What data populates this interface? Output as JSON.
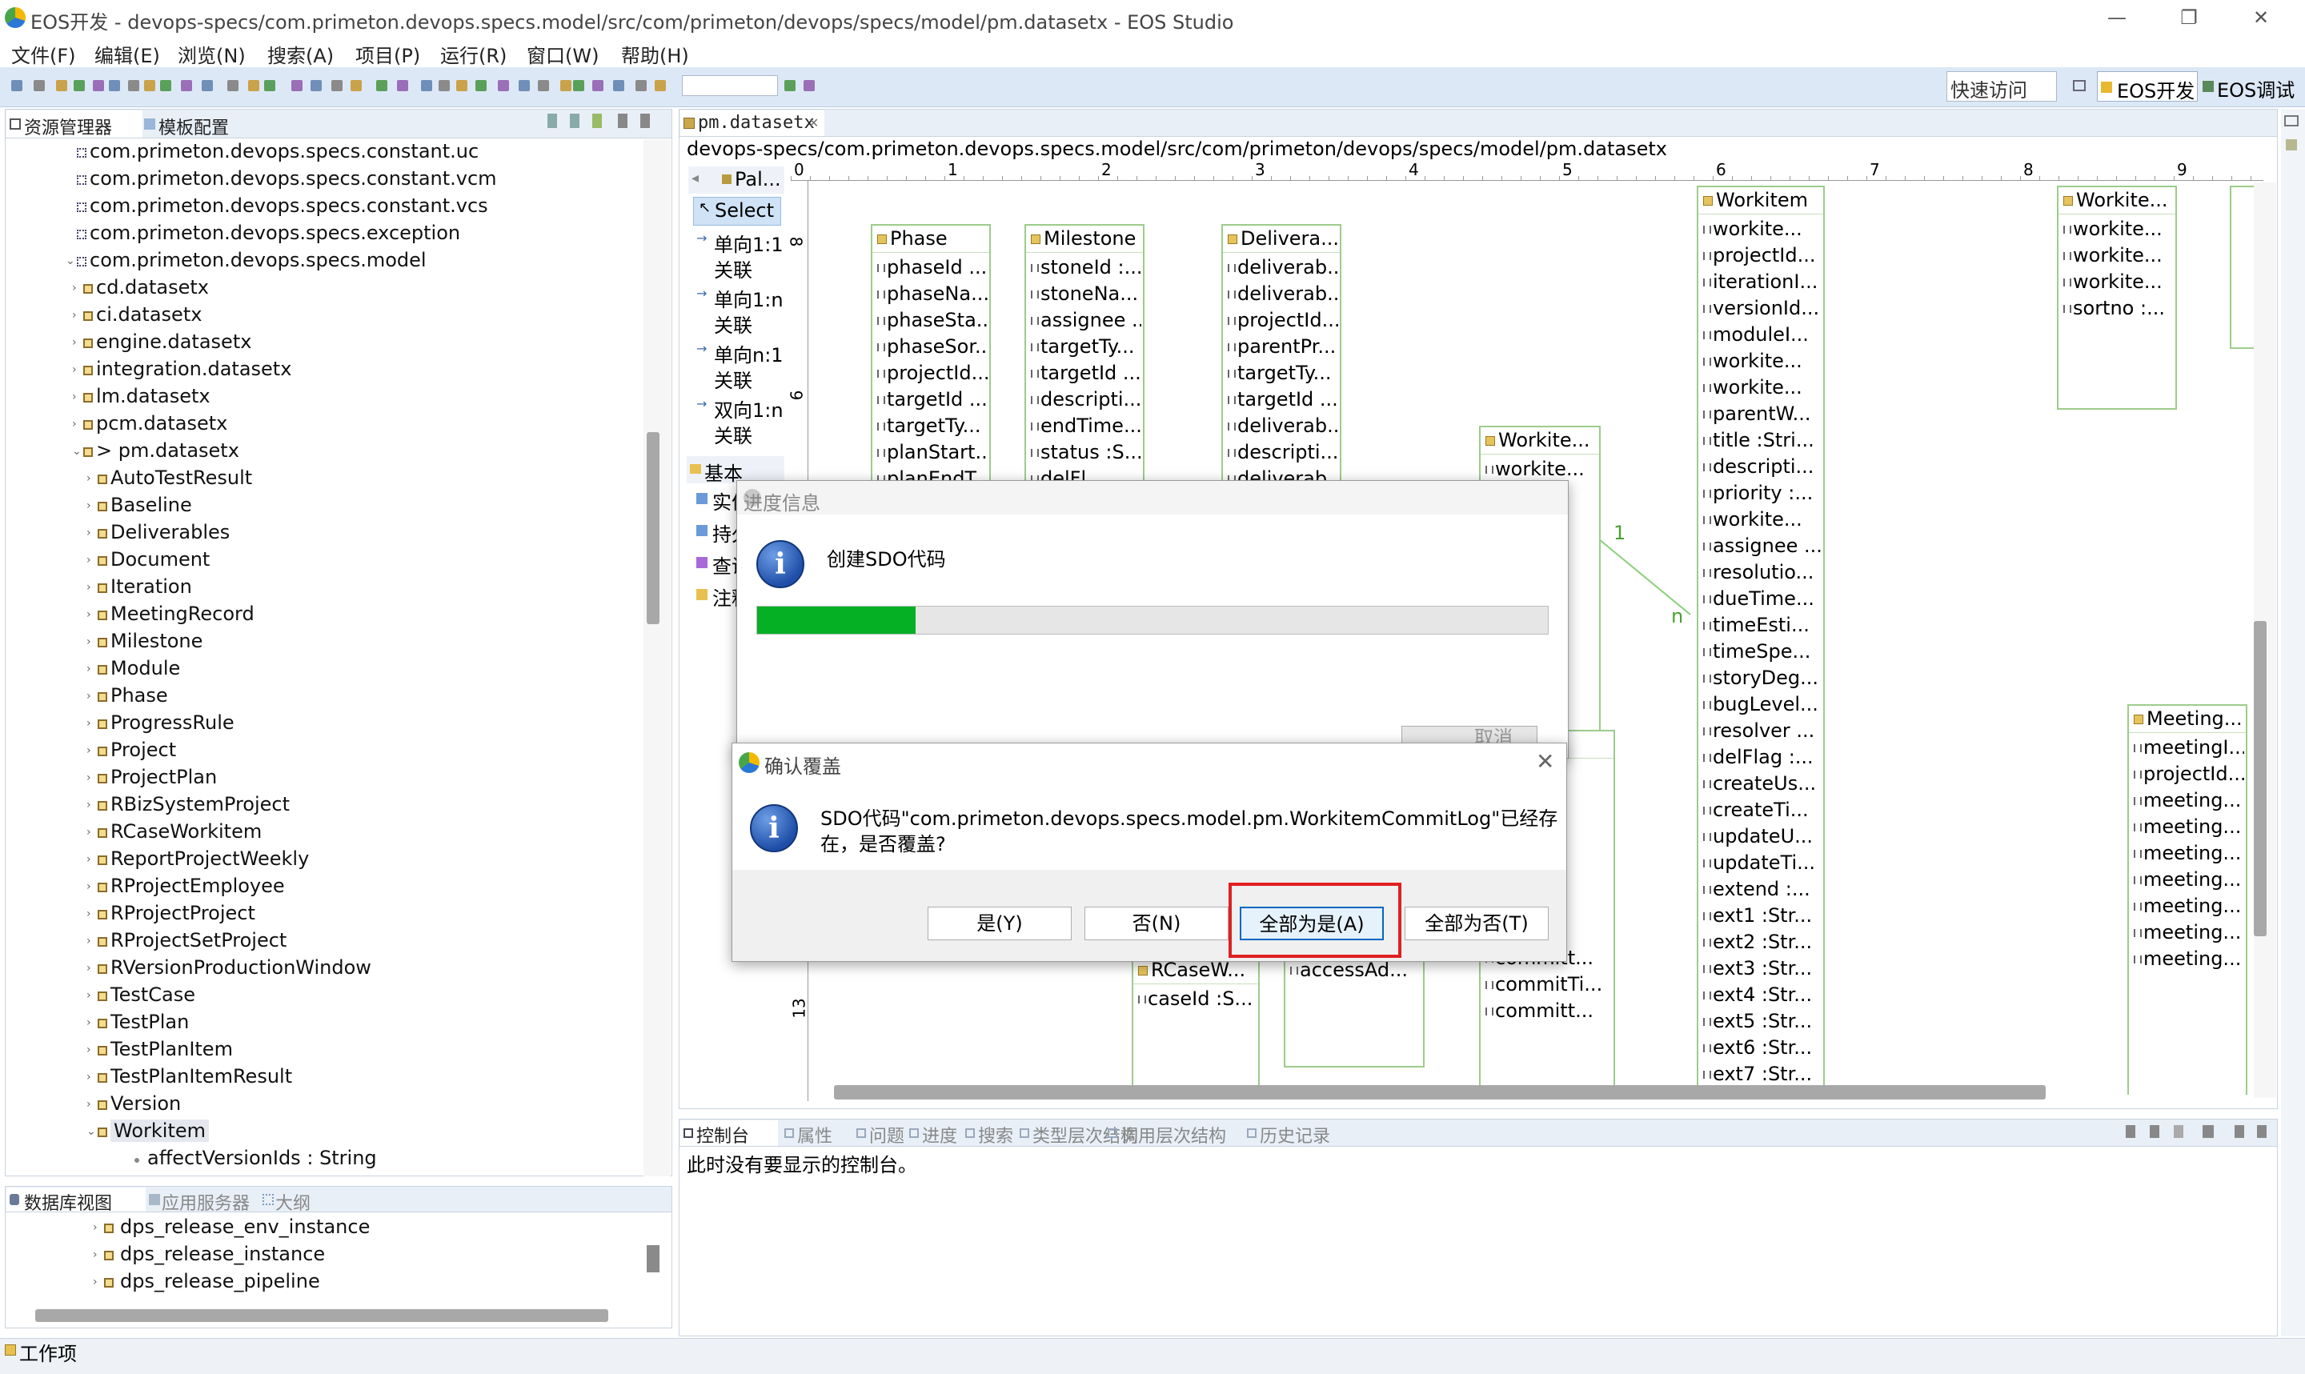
{
  "window": {
    "title": "EOS开发 - devops-specs/com.primeton.devops.specs.model/src/com/primeton/devops/specs/model/pm.datasetx - EOS Studio",
    "minimize": "—",
    "restore": "❐",
    "close": "✕"
  },
  "menu": [
    "文件(F)",
    "编辑(E)",
    "浏览(N)",
    "搜索(A)",
    "项目(P)",
    "运行(R)",
    "窗口(W)",
    "帮助(H)"
  ],
  "toolbar": {
    "quick_access_placeholder": "快速访问",
    "perspectives": [
      "EOS开发",
      "EOS调试"
    ]
  },
  "explorer": {
    "tabs": [
      "资源管理器",
      "模板配置"
    ],
    "items": [
      {
        "label": "com.primeton.devops.specs.constant.uc",
        "indent": 0,
        "arrow": "",
        "kind": "pkg"
      },
      {
        "label": "com.primeton.devops.specs.constant.vcm",
        "indent": 0,
        "arrow": "",
        "kind": "pkg"
      },
      {
        "label": "com.primeton.devops.specs.constant.vcs",
        "indent": 0,
        "arrow": "",
        "kind": "pkg"
      },
      {
        "label": "com.primeton.devops.specs.exception",
        "indent": 0,
        "arrow": "",
        "kind": "pkg"
      },
      {
        "label": "com.primeton.devops.specs.model",
        "indent": 0,
        "arrow": "⌄",
        "kind": "pkg"
      },
      {
        "label": "cd.datasetx",
        "indent": 1,
        "arrow": "›",
        "kind": "file"
      },
      {
        "label": "ci.datasetx",
        "indent": 1,
        "arrow": "›",
        "kind": "file"
      },
      {
        "label": "engine.datasetx",
        "indent": 1,
        "arrow": "›",
        "kind": "file"
      },
      {
        "label": "integration.datasetx",
        "indent": 1,
        "arrow": "›",
        "kind": "file"
      },
      {
        "label": "lm.datasetx",
        "indent": 1,
        "arrow": "›",
        "kind": "file"
      },
      {
        "label": "pcm.datasetx",
        "indent": 1,
        "arrow": "›",
        "kind": "file"
      },
      {
        "label": "> pm.datasetx",
        "indent": 1,
        "arrow": "⌄",
        "kind": "file"
      },
      {
        "label": "AutoTestResult",
        "indent": 2,
        "arrow": "›",
        "kind": "ent"
      },
      {
        "label": "Baseline",
        "indent": 2,
        "arrow": "›",
        "kind": "ent"
      },
      {
        "label": "Deliverables",
        "indent": 2,
        "arrow": "›",
        "kind": "ent"
      },
      {
        "label": "Document",
        "indent": 2,
        "arrow": "›",
        "kind": "ent"
      },
      {
        "label": "Iteration",
        "indent": 2,
        "arrow": "›",
        "kind": "ent"
      },
      {
        "label": "MeetingRecord",
        "indent": 2,
        "arrow": "›",
        "kind": "ent"
      },
      {
        "label": "Milestone",
        "indent": 2,
        "arrow": "›",
        "kind": "ent"
      },
      {
        "label": "Module",
        "indent": 2,
        "arrow": "›",
        "kind": "ent"
      },
      {
        "label": "Phase",
        "indent": 2,
        "arrow": "›",
        "kind": "ent"
      },
      {
        "label": "ProgressRule",
        "indent": 2,
        "arrow": "›",
        "kind": "ent"
      },
      {
        "label": "Project",
        "indent": 2,
        "arrow": "›",
        "kind": "ent"
      },
      {
        "label": "ProjectPlan",
        "indent": 2,
        "arrow": "›",
        "kind": "ent"
      },
      {
        "label": "RBizSystemProject",
        "indent": 2,
        "arrow": "›",
        "kind": "ent"
      },
      {
        "label": "RCaseWorkitem",
        "indent": 2,
        "arrow": "›",
        "kind": "ent"
      },
      {
        "label": "ReportProjectWeekly",
        "indent": 2,
        "arrow": "›",
        "kind": "ent"
      },
      {
        "label": "RProjectEmployee",
        "indent": 2,
        "arrow": "›",
        "kind": "ent"
      },
      {
        "label": "RProjectProject",
        "indent": 2,
        "arrow": "›",
        "kind": "ent"
      },
      {
        "label": "RProjectSetProject",
        "indent": 2,
        "arrow": "›",
        "kind": "ent"
      },
      {
        "label": "RVersionProductionWindow",
        "indent": 2,
        "arrow": "›",
        "kind": "ent"
      },
      {
        "label": "TestCase",
        "indent": 2,
        "arrow": "›",
        "kind": "ent"
      },
      {
        "label": "TestPlan",
        "indent": 2,
        "arrow": "›",
        "kind": "ent"
      },
      {
        "label": "TestPlanItem",
        "indent": 2,
        "arrow": "›",
        "kind": "ent"
      },
      {
        "label": "TestPlanItemResult",
        "indent": 2,
        "arrow": "›",
        "kind": "ent"
      },
      {
        "label": "Version",
        "indent": 2,
        "arrow": "›",
        "kind": "ent"
      },
      {
        "label": "Workitem",
        "indent": 2,
        "arrow": "⌄",
        "kind": "ent"
      },
      {
        "label": "affectVersionIds : String",
        "indent": 3,
        "arrow": "",
        "kind": "attr"
      }
    ]
  },
  "dbview": {
    "tabs": [
      "数据库视图",
      "应用服务器",
      "大纲"
    ],
    "items": [
      "dps_release_env_instance",
      "dps_release_instance",
      "dps_release_pipeline"
    ]
  },
  "editor": {
    "tab": "pm.datasetx",
    "path": "devops-specs/com.primeton.devops.specs.model/src/com/primeton/devops/specs/model/pm.datasetx",
    "ruler": [
      "0",
      "1",
      "2",
      "3",
      "4",
      "5",
      "6",
      "7",
      "8",
      "9"
    ],
    "vruler": [
      "8",
      "9",
      "13"
    ],
    "palette": {
      "header": "Pal...",
      "select": "Select",
      "items": [
        "单向1:1\n关联",
        "单向1:n\n关联",
        "单向n:1\n关联",
        "双向1:n\n关联"
      ],
      "basic": "基本",
      "basic_items": [
        "实体",
        "持久化实体",
        "查询实体",
        "注释"
      ]
    },
    "conn_labels": [
      "1",
      "n"
    ],
    "entities": [
      {
        "title": "Phase",
        "rows": [
          "phaseId ...",
          "phaseNa...",
          "phaseSta...",
          "phaseSor...",
          "projectId...",
          "targetId ...",
          "targetTy...",
          "planStart...",
          "planEndT..."
        ]
      },
      {
        "title": "Milestone",
        "rows": [
          "stoneId :...",
          "stoneNa...",
          "assignee ...",
          "targetTy...",
          "targetId ...",
          "descripti...",
          "endTime...",
          "status :S...",
          "delFl..."
        ]
      },
      {
        "title": "Delivera...",
        "rows": [
          "deliverab...",
          "deliverab...",
          "projectId...",
          "parentPr...",
          "targetTy...",
          "targetId ...",
          "deliverab...",
          "descripti...",
          "deliverab..."
        ]
      },
      {
        "title": "Workite...",
        "rows": [
          "workite...",
          "...",
          "..."
        ]
      },
      {
        "title": "Workitem",
        "rows": [
          "workite...",
          "projectId...",
          "iterationI...",
          "versionId...",
          "moduleI...",
          "workite...",
          "workite...",
          "parentW...",
          "title :Stri...",
          "descripti...",
          "priority :...",
          "workite...",
          "assignee ...",
          "resolutio...",
          "dueTime...",
          "timeEsti...",
          "timeSpe...",
          "storyDeg...",
          "bugLevel...",
          "resolver ...",
          "delFlag :...",
          "createUs...",
          "createTi...",
          "updateU...",
          "updateTi...",
          "extend :...",
          "ext1 :Str...",
          "ext2 :Str...",
          "ext3 :Str...",
          "ext4 :Str...",
          "ext5 :Str...",
          "ext6 :Str...",
          "ext7 :Str..."
        ]
      },
      {
        "title": "Workite...",
        "rows": [
          "workite...",
          "workite...",
          "workite...",
          "sortno :..."
        ]
      },
      {
        "title": "Meeting...",
        "rows": [
          "meetingI...",
          "projectId...",
          "meeting...",
          "meeting...",
          "meeting...",
          "meeting...",
          "meeting...",
          "meeting...",
          "meeting..."
        ]
      },
      {
        "title": "...te...",
        "rows": [
          "...tL...",
          "...te...",
          "...te...",
          "...tId...",
          "...d :...",
          "...rl :...",
          "...hN...",
          "committ...",
          "commitTi...",
          "committ..."
        ]
      },
      {
        "title": "RCaseW...",
        "rows": [
          "caseId :S..."
        ]
      },
      {
        "title": "",
        "rows": [
          "accessAd..."
        ]
      }
    ]
  },
  "console": {
    "tabs": [
      "控制台",
      "属性",
      "问题",
      "进度",
      "搜索",
      "类型层次结构",
      "调用层次结构",
      "历史记录"
    ],
    "message": "此时没有要显示的控制台。"
  },
  "progress_dialog": {
    "title": "进度信息",
    "message": "创建SDO代码",
    "progress": 0.2,
    "cancel": "取消"
  },
  "confirm_dialog": {
    "title": "确认覆盖",
    "message_line1": "SDO代码\"com.primeton.devops.specs.model.pm.WorkitemCommitLog\"已经存",
    "message_line2": "在，是否覆盖?",
    "buttons": [
      "是(Y)",
      "否(N)",
      "全部为是(A)",
      "全部为否(T)"
    ],
    "highlight_color": "#e02020"
  },
  "statusbar": {
    "text": "工作项"
  },
  "colors": {
    "progress_fill": "#06b025",
    "entity_border": "#9dcc8b",
    "toolbar_bg": "#dde8f6"
  }
}
